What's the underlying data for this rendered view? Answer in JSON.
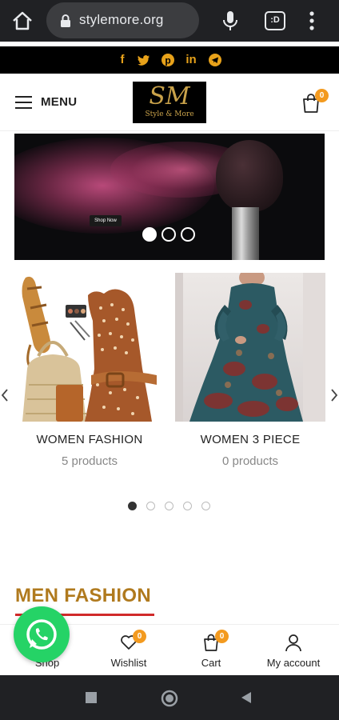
{
  "browser": {
    "url": "stylemore.org",
    "tabs_label": ":D"
  },
  "social": {
    "icons": [
      "facebook-icon",
      "twitter-icon",
      "pinterest-icon",
      "linkedin-icon",
      "telegram-icon"
    ],
    "glyphs": [
      "f",
      "t",
      "p",
      "in",
      "➤"
    ],
    "color": "#e8a21a"
  },
  "header": {
    "menu_label": "MENU",
    "logo_monogram": "SM",
    "logo_text": "Style & More",
    "cart_count": "0"
  },
  "hero": {
    "button_label": "Shop Now",
    "slide_count": 3,
    "active_slide": 1
  },
  "categories": [
    {
      "title": "WOMEN FASHION",
      "count": "5 products"
    },
    {
      "title": "WOMEN 3 PIECE",
      "count": "0 products"
    }
  ],
  "carousel": {
    "pages": 5,
    "active": 1
  },
  "section": {
    "title": "MEN FASHION"
  },
  "bottom_nav": {
    "items": [
      {
        "label": "Shop",
        "icon": "shop-icon"
      },
      {
        "label": "Wishlist",
        "icon": "heart-icon",
        "badge": "0"
      },
      {
        "label": "Cart",
        "icon": "cart-icon",
        "badge": "0"
      },
      {
        "label": "My account",
        "icon": "user-icon"
      }
    ]
  },
  "colors": {
    "accent": "#f39a1f",
    "section_title": "#b07a1e",
    "section_underline": "#d12a2a",
    "whatsapp": "#25d366"
  }
}
